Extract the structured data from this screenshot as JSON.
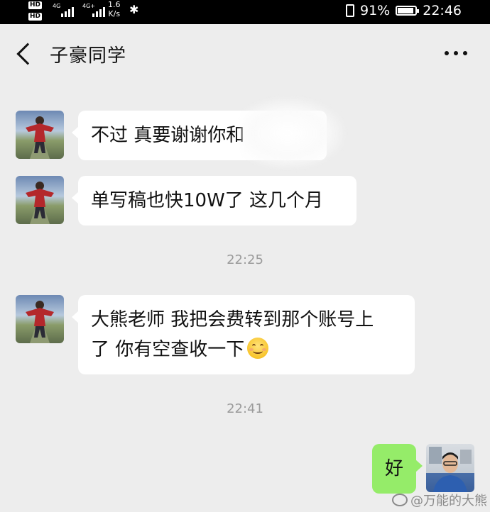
{
  "status_bar": {
    "hd1": "HD",
    "hd2": "HD",
    "net1": "4G",
    "net2": "4G+",
    "speed_value": "1.6",
    "speed_unit": "K/s",
    "battery_percent": "91%",
    "time": "22:46"
  },
  "header": {
    "title": "子豪同学"
  },
  "messages": [
    {
      "from": "other",
      "text": "不过 真要谢谢你和"
    },
    {
      "from": "other",
      "text": "单写稿也快10W了 这几个月"
    },
    {
      "from": "other",
      "text_line1": "大熊老师 我把会费转到那个账号上",
      "text_line2": "了 你有空查收一下",
      "emoji": "smile-emoji"
    },
    {
      "from": "me",
      "text": "好"
    }
  ],
  "timestamps": [
    "22:25",
    "22:41"
  ],
  "watermark": "@万能的大熊",
  "colors": {
    "background": "#ededed",
    "incoming_bubble": "#ffffff",
    "outgoing_bubble": "#95ec69",
    "timestamp": "#9b9b9b"
  }
}
